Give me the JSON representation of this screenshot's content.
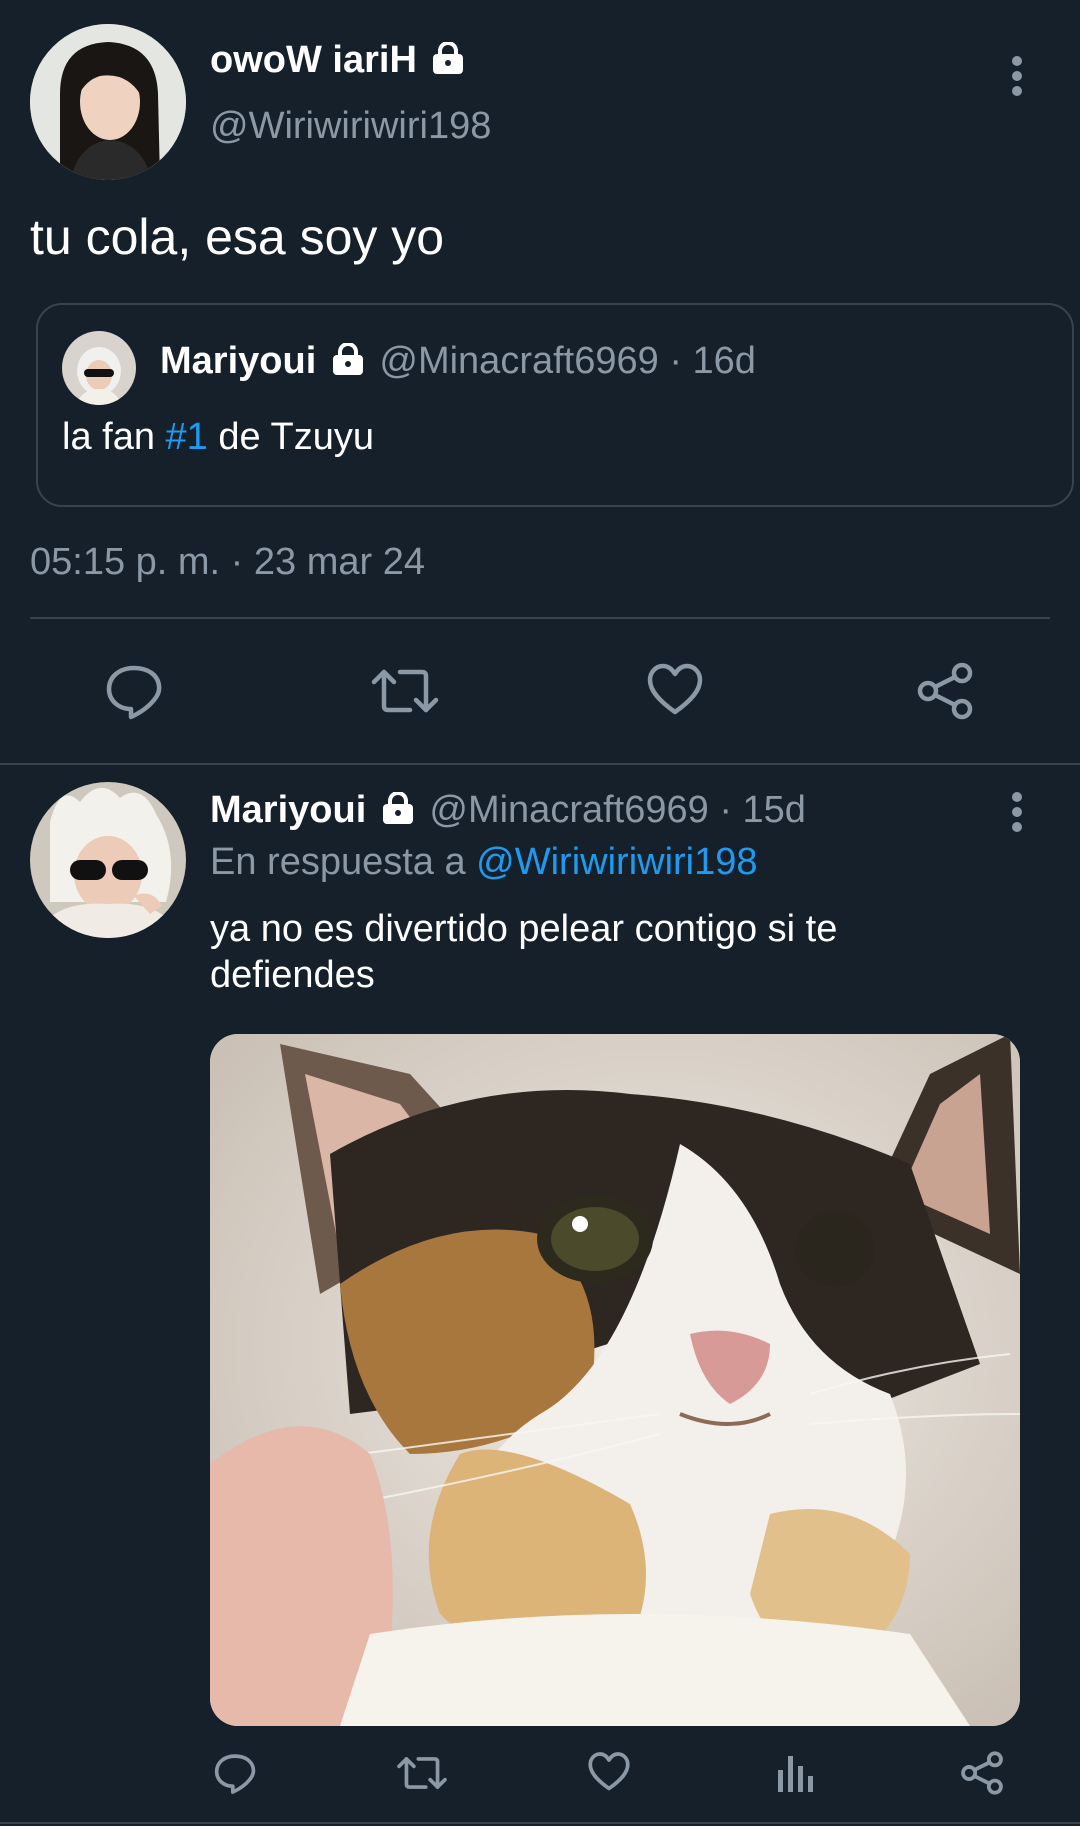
{
  "main_tweet": {
    "display_name": "owoW iariH",
    "handle": "@Wiriwiriwiri198",
    "text": "tu cola, esa soy yo",
    "timestamp": "05:15 p. m. · 23 mar 24",
    "quoted": {
      "display_name": "Mariyoui",
      "handle": "@Minacraft6969",
      "age": "· 16d",
      "text_before": "la fan ",
      "hashtag": "#1",
      "text_after": " de Tzuyu"
    },
    "actions": [
      "reply-icon",
      "retweet-icon",
      "like-icon",
      "share-icon"
    ]
  },
  "reply_tweet": {
    "display_name": "Mariyoui",
    "handle": "@Minacraft6969",
    "age": "· 15d",
    "reply_prefix": "En respuesta a ",
    "reply_to": "@Wiriwiriwiri198",
    "text": "ya no es divertido pelear contigo si te defiendes",
    "media": "calico-cat-photo",
    "actions": [
      "reply-icon",
      "retweet-icon",
      "like-icon",
      "analytics-icon",
      "share-icon"
    ]
  },
  "colors": {
    "background": "#15202b",
    "muted": "#8b98a5",
    "link": "#1d9bf0",
    "divider": "#38444d"
  }
}
